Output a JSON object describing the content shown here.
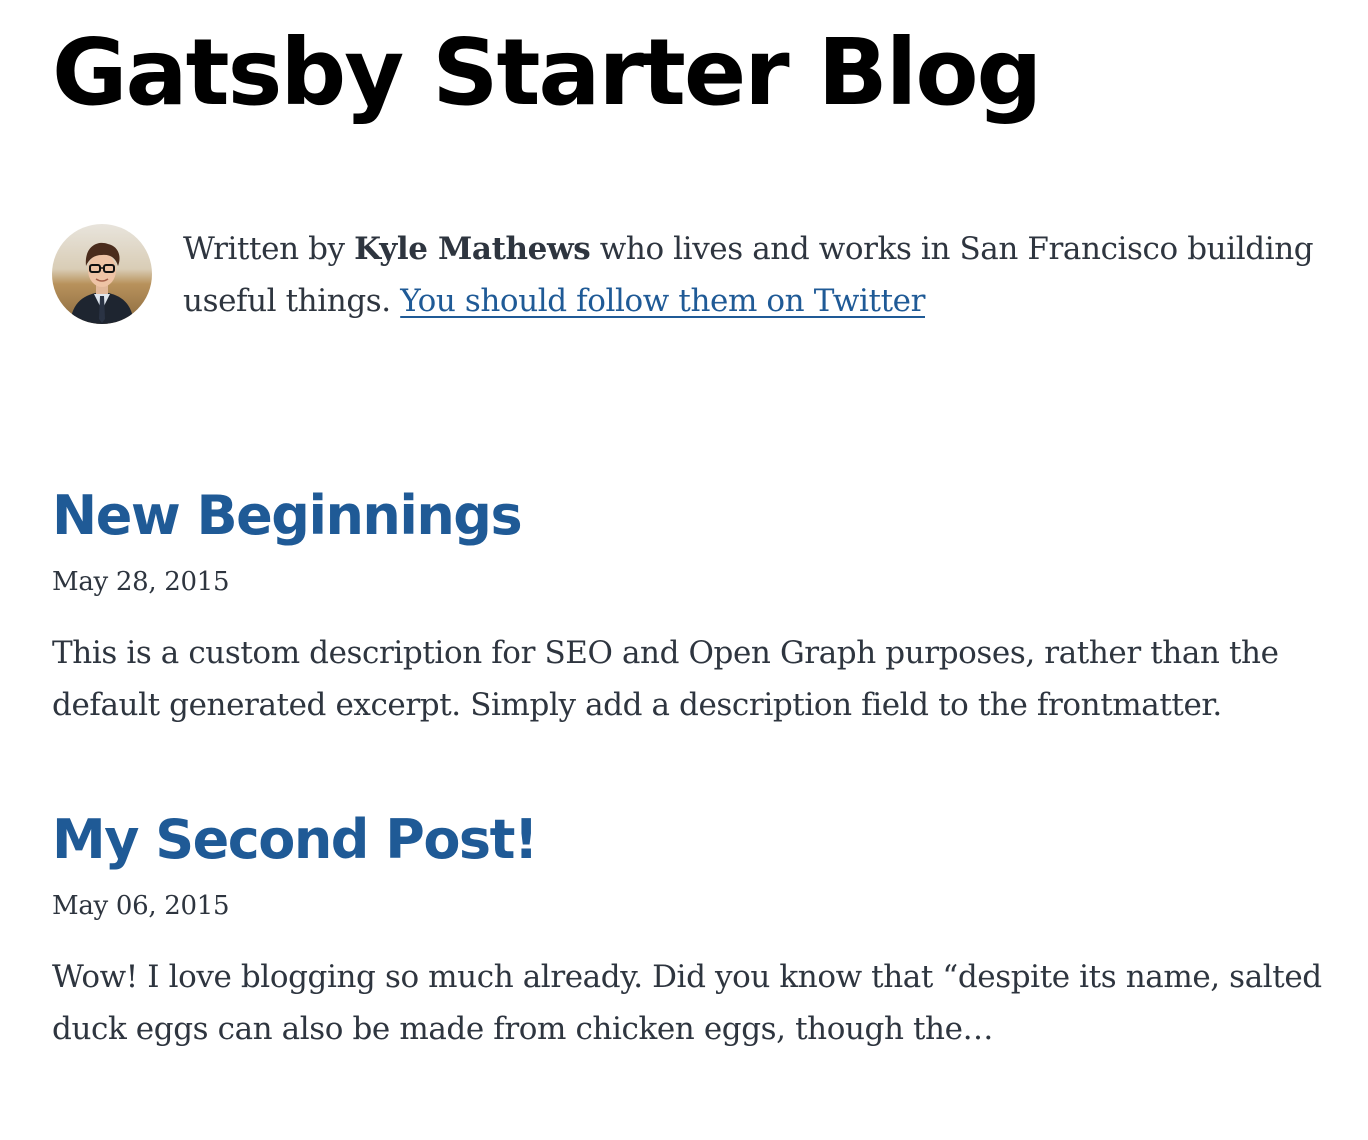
{
  "site": {
    "title": "Gatsby Starter Blog"
  },
  "bio": {
    "prefix": "Written by ",
    "author": "Kyle Mathews",
    "middle": " who lives and works in San Francisco building useful things. ",
    "link_label": "You should follow them on Twitter"
  },
  "posts": [
    {
      "title": "New Beginnings",
      "date": "May 28, 2015",
      "excerpt": "This is a custom description for SEO and Open Graph purposes, rather than the default generated excerpt. Simply add a description field to the frontmatter."
    },
    {
      "title": "My Second Post!",
      "date": "May 06, 2015",
      "excerpt": "Wow! I love blogging so much already. Did you know that “despite its name, salted duck eggs can also be made from chicken eggs, though the…"
    }
  ],
  "colors": {
    "link": "#1f5a96",
    "text": "#2e353f",
    "title": "#000000"
  },
  "icons": {
    "avatar": "author-avatar-photo"
  }
}
